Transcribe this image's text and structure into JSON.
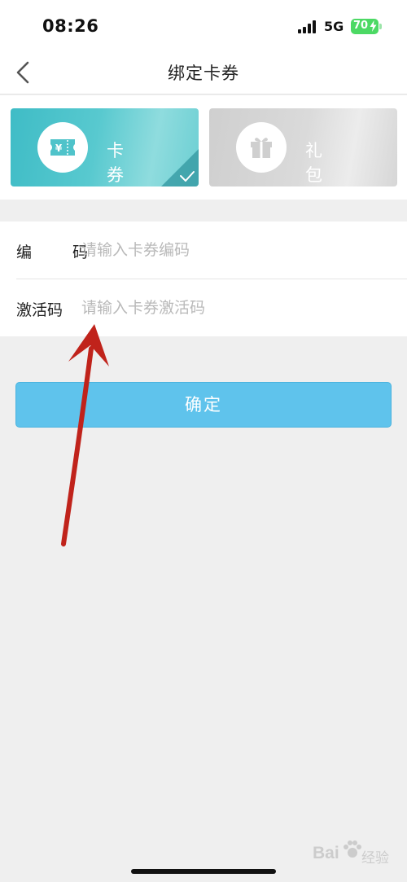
{
  "status_bar": {
    "time": "08:26",
    "network": "5G",
    "battery_level": "70",
    "battery_color": "#4cd964"
  },
  "nav": {
    "title": "绑定卡券",
    "back_icon": "chevron-left-icon"
  },
  "tabs": [
    {
      "label": "卡 券",
      "icon": "coupon-ticket-icon",
      "selected": true,
      "color": "#4fc3ca"
    },
    {
      "label": "礼 包",
      "icon": "gift-box-icon",
      "selected": false,
      "color": "#d4d4d4"
    }
  ],
  "form": {
    "code": {
      "label": "编 码",
      "placeholder": "请输入卡券编码",
      "value": ""
    },
    "activation": {
      "label": "激活码",
      "placeholder": "请输入卡券激活码",
      "value": ""
    }
  },
  "confirm": {
    "label": "确定",
    "color": "#5fc3ec"
  },
  "annotation": {
    "color": "#c0231b"
  },
  "watermark": {
    "text": "Bai",
    "sub": "经验"
  }
}
